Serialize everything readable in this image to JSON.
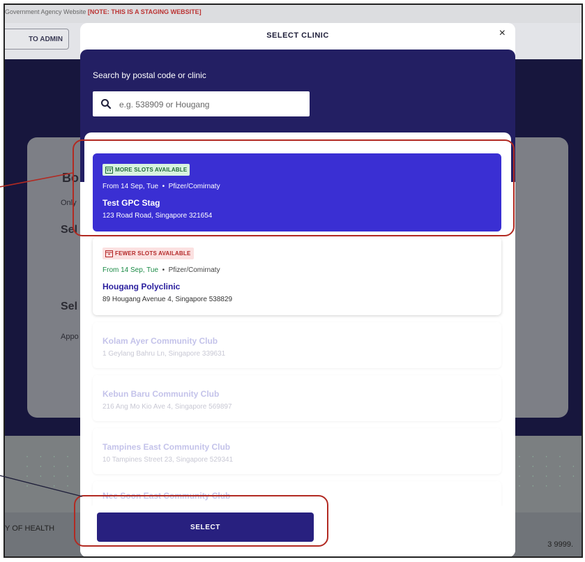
{
  "background": {
    "notice": "Government Agency Website",
    "notice_warning": "[NOTE: THIS IS A STAGING WEBSITE]",
    "admin_button": "TO ADMIN",
    "card_heading": "Bo",
    "card_sub": "Only",
    "card_label_1": "Sel",
    "card_label_2": "Sel",
    "card_text": "Appo",
    "footer_left": "Y OF HEALTH",
    "footer_right": "3 9999."
  },
  "modal": {
    "title": "SELECT CLINIC",
    "close_symbol": "×",
    "search": {
      "label": "Search by postal code or clinic",
      "placeholder": "e.g. 538909 or Hougang",
      "value": ""
    },
    "select_button": "SELECT"
  },
  "clinics": [
    {
      "badge": "MORE SLOTS AVAILABLE",
      "date": "From 14 Sep, Tue",
      "vaccine": "Pfizer/Comirnaty",
      "name": "Test GPC Stag",
      "address": "123 Road Road, Singapore 321654",
      "state": "selected"
    },
    {
      "badge": "FEWER SLOTS AVAILABLE",
      "date": "From 14 Sep, Tue",
      "vaccine": "Pfizer/Comirnaty",
      "name": "Hougang Polyclinic",
      "address": "89 Hougang Avenue 4, Singapore 538829",
      "state": "available"
    },
    {
      "name": "Kolam Ayer Community Club",
      "address": "1 Geylang Bahru Ln, Singapore 339631",
      "state": "disabled"
    },
    {
      "name": "Kebun Baru Community Club",
      "address": "216 Ang Mo Kio Ave 4, Singapore 569897",
      "state": "disabled"
    },
    {
      "name": "Tampines East Community Club",
      "address": "10 Tampines Street 23, Singapore 529341",
      "state": "disabled"
    },
    {
      "name": "Nee Soon East Community Club",
      "state": "disabled"
    }
  ],
  "colors": {
    "selected_card": "#3a2fd3",
    "search_panel": "#231f63",
    "select_button": "#28207f",
    "highlight": "#b22a22",
    "badge_more": "#d8f3df",
    "badge_fewer": "#fbe1e1"
  }
}
